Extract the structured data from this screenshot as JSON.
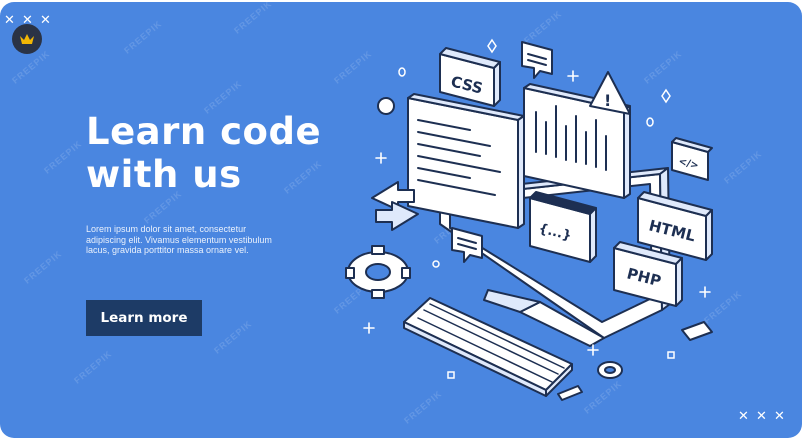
{
  "banner": {
    "title_line1": "Learn code",
    "title_line2": "with us",
    "description": "Lorem ipsum dolor sit amet, consectetur adipiscing elit. Vivamus elementum vestibulum lacus, gravida porttitor massa ornare vel.",
    "cta_label": "Learn more",
    "background_color": "#4a86e0",
    "cta_color": "#1d3b66"
  },
  "illustration": {
    "labels": {
      "css": "CSS",
      "html": "HTML",
      "php": "PHP",
      "braces": "{...}",
      "tag": "</>",
      "warning": "!"
    },
    "icons": [
      "monitor-icon",
      "keyboard-icon",
      "gear-icon",
      "refresh-arrows-icon",
      "warning-icon",
      "chat-bubble-icon"
    ]
  },
  "overlay": {
    "badge_icon": "crown-icon",
    "watermark_text": "FREEPIK"
  }
}
